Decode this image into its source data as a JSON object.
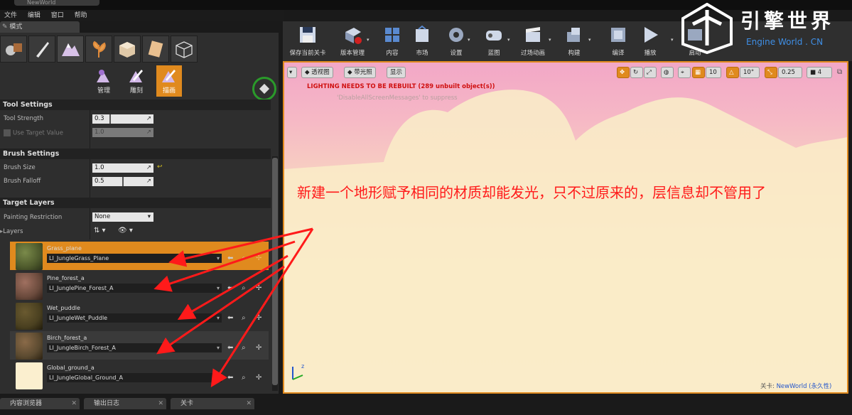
{
  "window": {
    "doc_tab": "NewWorld"
  },
  "menu": [
    "文件",
    "编辑",
    "窗口",
    "帮助"
  ],
  "modes_panel": {
    "tab_label": "模式",
    "sub_modes": [
      {
        "label": "管理"
      },
      {
        "label": "雕刻"
      },
      {
        "label": "描画"
      }
    ],
    "tool_settings": {
      "title": "Tool Settings",
      "tool_strength_label": "Tool Strength",
      "tool_strength": "0.3",
      "use_target_label": "Use Target Value",
      "use_target": "1.0"
    },
    "brush_settings": {
      "title": "Brush Settings",
      "size_label": "Brush Size",
      "size": "1.0",
      "falloff_label": "Brush Falloff",
      "falloff": "0.5"
    },
    "target_layers": {
      "title": "Target Layers",
      "painting_restriction_label": "Painting Restriction",
      "painting_restriction": "None",
      "layers_label": "Layers"
    },
    "layers": [
      {
        "name": "Grass_plane",
        "material": "LI_JungleGrass_Plane",
        "thumb": "#4e5a2c"
      },
      {
        "name": "Pine_forest_a",
        "material": "LI_JunglePine_Forest_A",
        "thumb": "#6a4a3c"
      },
      {
        "name": "Wet_puddle",
        "material": "LI_JungleWet_Puddle",
        "thumb": "#4a4020"
      },
      {
        "name": "Birch_forest_a",
        "material": "LI_JungleBirch_Forest_A",
        "thumb": "#5b4a30"
      },
      {
        "name": "Global_ground_a",
        "material": "LI_JungleGlobal_Ground_A",
        "thumb": "#fbefcf"
      }
    ]
  },
  "toolbar": [
    {
      "label": "保存当前关卡",
      "icon": "save-icon"
    },
    {
      "label": "版本管理",
      "icon": "source-control-icon"
    },
    {
      "label": "内容",
      "icon": "content-icon"
    },
    {
      "label": "市场",
      "icon": "marketplace-icon"
    },
    {
      "label": "设置",
      "icon": "settings-icon"
    },
    {
      "label": "蓝图",
      "icon": "blueprint-icon"
    },
    {
      "label": "过场动画",
      "icon": "cinematics-icon"
    },
    {
      "label": "构建",
      "icon": "build-icon"
    },
    {
      "label": "编译",
      "icon": "compile-icon"
    },
    {
      "label": "播放",
      "icon": "play-icon"
    },
    {
      "label": "启动",
      "icon": "launch-icon"
    }
  ],
  "viewport": {
    "buttons": {
      "perspective": "透视图",
      "lit": "带光照",
      "show": "显示"
    },
    "grid_snap": "10",
    "rotation_snap": "10°",
    "scale_snap": "0.25",
    "camera_speed": "4",
    "warning": "LIGHTING NEEDS TO BE REBUILT (289 unbuilt object(s))",
    "hint": "'DisableAllScreenMessages' to suppress",
    "annotation": "新建一个地形赋予相同的材质却能发光，只不过原来的，层信息却不管用了",
    "status_prefix": "关卡: ",
    "status_level": "NewWorld (永久性)"
  },
  "bottom_tabs": [
    "内容浏览器",
    "输出日志",
    "关卡"
  ],
  "watermark": {
    "title": "引擎世界",
    "subtitle": "Engine World . CN"
  }
}
